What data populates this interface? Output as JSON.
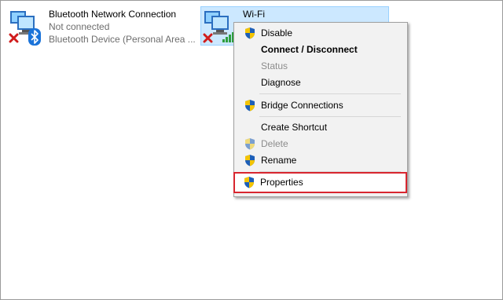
{
  "connections": [
    {
      "name": "Bluetooth Network Connection",
      "status": "Not connected",
      "device": "Bluetooth Device (Personal Area ..."
    },
    {
      "name": "Wi-Fi"
    }
  ],
  "context_menu": {
    "items": [
      {
        "label": "Disable",
        "icon": "uac-shield-icon",
        "state": "normal"
      },
      {
        "label": "Connect / Disconnect",
        "icon": null,
        "state": "bold"
      },
      {
        "label": "Status",
        "icon": null,
        "state": "disabled"
      },
      {
        "label": "Diagnose",
        "icon": null,
        "state": "normal"
      },
      {
        "label": "Bridge Connections",
        "icon": "uac-shield-icon",
        "state": "normal"
      },
      {
        "label": "Create Shortcut",
        "icon": null,
        "state": "normal"
      },
      {
        "label": "Delete",
        "icon": "uac-shield-icon",
        "state": "disabled"
      },
      {
        "label": "Rename",
        "icon": "uac-shield-icon",
        "state": "normal"
      },
      {
        "label": "Properties",
        "icon": "uac-shield-icon",
        "state": "highlighted"
      }
    ]
  },
  "colors": {
    "selection_bg": "#cce8ff",
    "menu_bg": "#f2f2f2",
    "highlight_border": "#d8262f",
    "status_text": "#6d6d6d"
  }
}
